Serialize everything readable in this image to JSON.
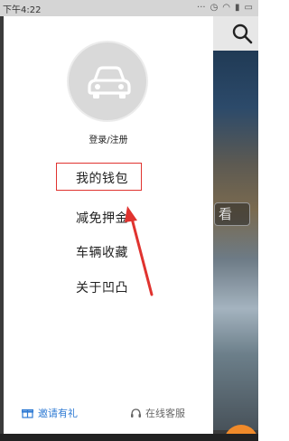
{
  "status_bar": {
    "time": "下午4:22",
    "icons": [
      "...",
      "alarm",
      "wifi",
      "signal",
      "battery"
    ]
  },
  "background": {
    "overlay_button_label": "看"
  },
  "drawer": {
    "login_label": "登录/注册",
    "menu": [
      {
        "label": "我的钱包",
        "highlighted": true
      },
      {
        "label": "减免押金"
      },
      {
        "label": "车辆收藏"
      },
      {
        "label": "关于凹凸"
      }
    ],
    "bottom": {
      "invite_label": "邀请有礼",
      "service_label": "在线客服"
    }
  },
  "colors": {
    "highlight_box": "#e0332f",
    "invite_blue": "#2f7bd4",
    "arrow_red": "#e0332f"
  }
}
